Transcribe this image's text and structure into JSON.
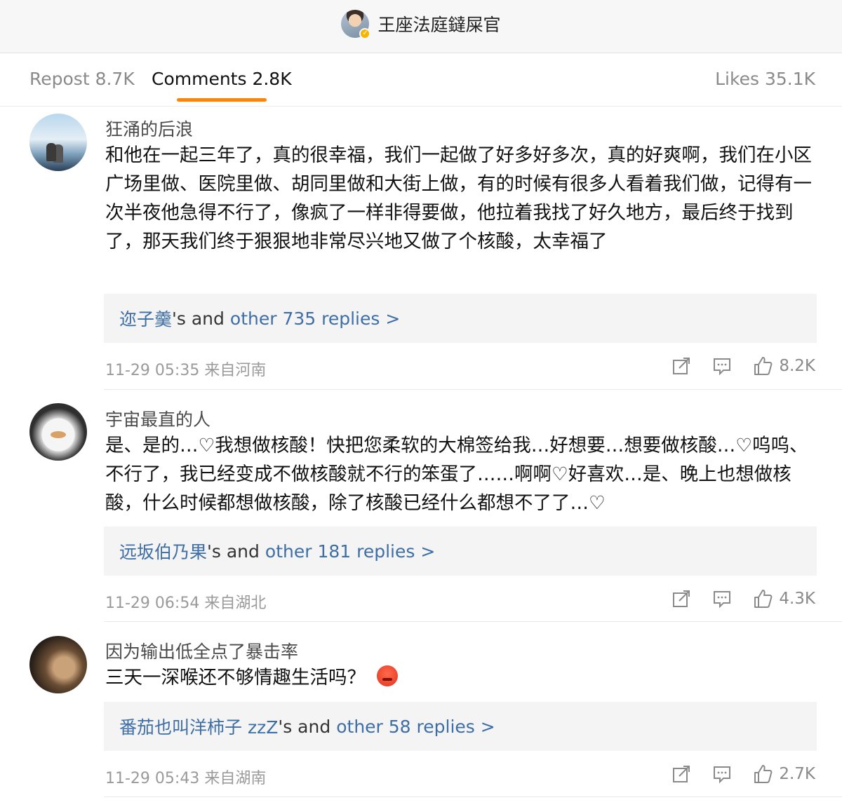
{
  "header": {
    "title": "王座法庭鐽屎官"
  },
  "tabs": {
    "repost": "Repost 8.7K",
    "comments": "Comments 2.8K",
    "likes": "Likes 35.1K"
  },
  "comments": [
    {
      "username": "狂涌的后浪",
      "text": "和他在一起三年了，真的很幸福，我们一起做了好多好多次，真的好爽啊，我们在小区广场里做、医院里做、胡同里做和大街上做，有的时候有很多人看着我们做，记得有一次半夜他急得不行了，像疯了一样非得要做，他拉着我找了好久地方，最后终于找到了，那天我们终于狠狠地非常尽兴地又做了个核酸，太幸福了",
      "reply_name": "迩子羹",
      "reply_mid": "'s and",
      "reply_count": "other 735 replies >",
      "meta": "11-29 05:35 来自河南",
      "likes": "8.2K"
    },
    {
      "username": "宇宙最直的人",
      "text": "是、是的…♡我想做核酸！快把您柔软的大棉签给我…好想要…想要做核酸…♡呜呜、不行了，我已经变成不做核酸就不行的笨蛋了……啊啊♡好喜欢…是、晚上也想做核酸，什么时候都想做核酸，除了核酸已经什么都想不了了…♡",
      "reply_name": "远坂伯乃果",
      "reply_mid": "'s and",
      "reply_count": "other 181 replies >",
      "meta": "11-29 06:54 来自湖北",
      "likes": "4.3K"
    },
    {
      "username": "因为输出低全点了暴击率",
      "text": "三天一深喉还不够情趣生活吗？",
      "reply_name": "番茄也叫洋柿子 zzZ",
      "reply_mid": "'s and",
      "reply_count": "other 58 replies >",
      "meta": "11-29 05:43 来自湖南",
      "likes": "2.7K"
    }
  ],
  "icons": {
    "verified": "verified-badge-icon",
    "share": "share-icon",
    "comment": "comment-icon",
    "like": "thumbs-up-icon"
  },
  "colors": {
    "accent": "#ff8200",
    "link": "#3d6ea6",
    "verified": "#f7b500"
  }
}
